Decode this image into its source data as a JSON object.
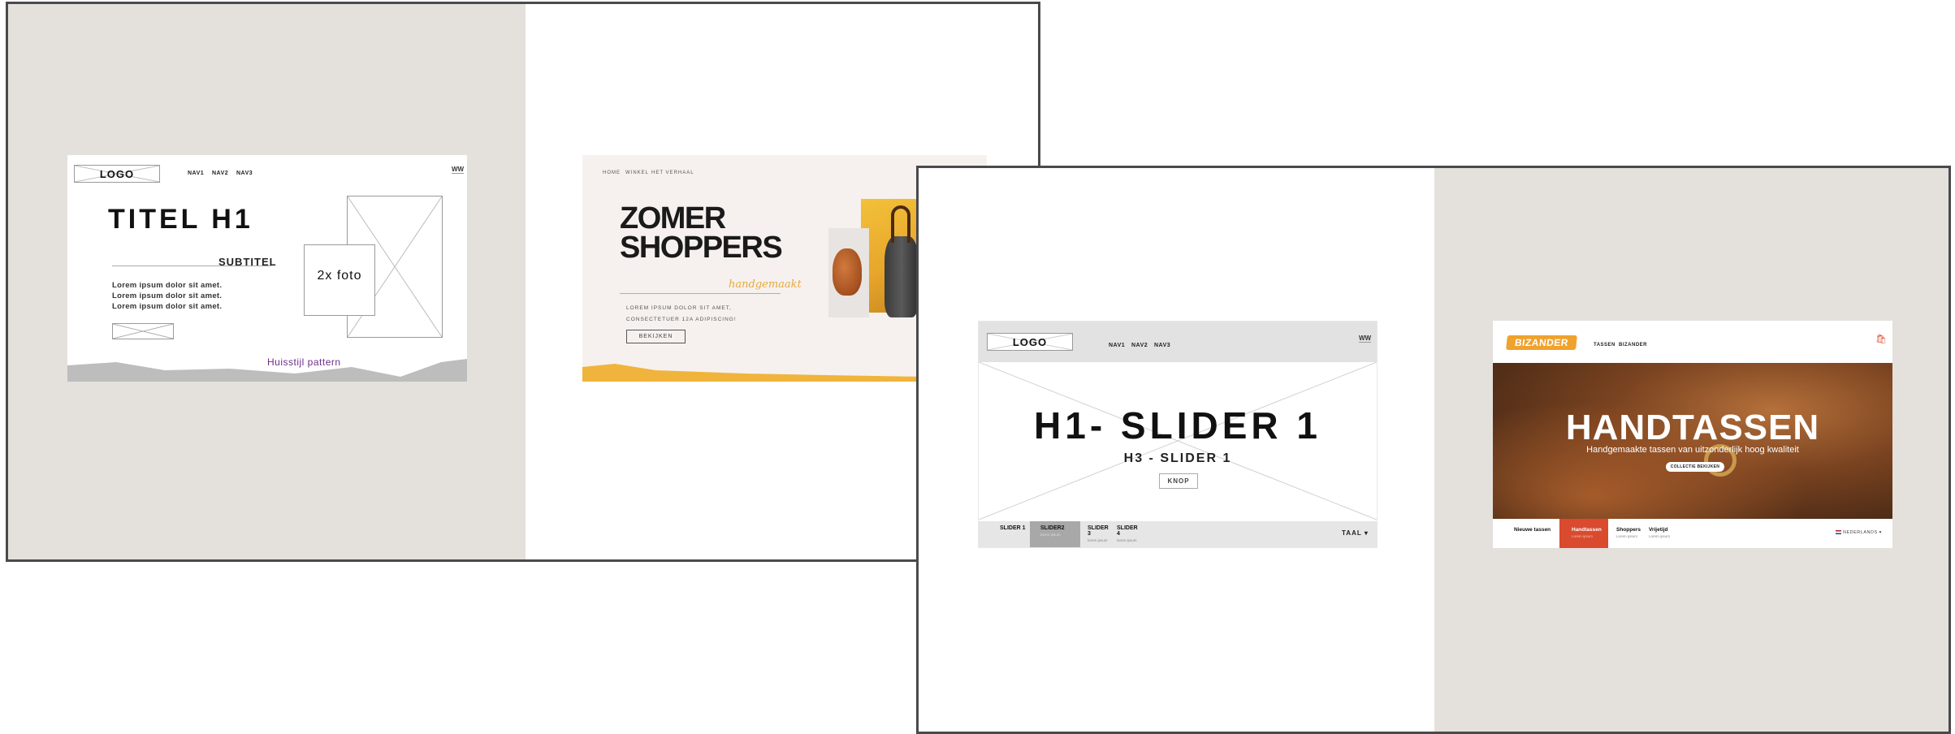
{
  "board1": {
    "wireframe": {
      "logo": "LOGO",
      "nav": [
        "NAV1",
        "NAV2",
        "NAV3"
      ],
      "corner_badge": "WW",
      "title": "TITEL H1",
      "subtitle": "SUBTITEL",
      "lorem_lines": [
        "Lorem ipsum dolor sit amet.",
        "Lorem ipsum dolor sit amet.",
        "Lorem ipsum dolor sit amet."
      ],
      "photo_label": "2x foto",
      "pattern_label": "Huisstijl pattern"
    },
    "design": {
      "nav": [
        "HOME",
        "WINKEL",
        "HET VERHAAL"
      ],
      "heading_line1": "ZOMER",
      "heading_line2": "SHOPPERS",
      "script_text": "handgemaakt",
      "body_line1": "LOREM IPSUM DOLOR SIT AMET,",
      "body_line2": "CONSECTETUER 12A ADIPISCING!",
      "button": "BEKIJKEN"
    }
  },
  "board2": {
    "wireframe": {
      "logo": "LOGO",
      "nav": [
        "NAV1",
        "NAV2",
        "NAV3"
      ],
      "corner_badge": "WW",
      "h1": "H1- SLIDER 1",
      "h3": "H3 - SLIDER 1",
      "button": "KNOP",
      "tabs": [
        {
          "label": "SLIDER 1",
          "sub": ""
        },
        {
          "label": "SLIDER2",
          "sub": "lorem ipsum"
        },
        {
          "label": "SLIDER 3",
          "sub": "lorem ipsum"
        },
        {
          "label": "SLIDER 4",
          "sub": "lorem ipsum"
        }
      ],
      "language": "TAAL"
    },
    "design": {
      "logo": "BIZANDER",
      "nav": [
        "TASSEN",
        "BIZANDER"
      ],
      "hero_title": "HANDTASSEN",
      "hero_subtitle": "Handgemaakte tassen van uitzonderlijk hoog kwaliteit",
      "hero_button": "COLLECTIE BEKIJKEN",
      "tabs": [
        {
          "label": "Nieuwe tassen",
          "sub": ""
        },
        {
          "label": "Handtassen",
          "sub": "Lorem ipsum"
        },
        {
          "label": "Shoppers",
          "sub": "Lorem ipsum"
        },
        {
          "label": "Vrijetijd",
          "sub": "Lorem ipsum"
        }
      ],
      "language": "NEDERLANDS"
    }
  },
  "colors": {
    "beige": "#e4e0dc",
    "board_border": "#4a4a4d",
    "accent_yellow": "#f0b43c",
    "accent_red": "#d94a2f",
    "pattern_purple": "#6a2c8c"
  }
}
